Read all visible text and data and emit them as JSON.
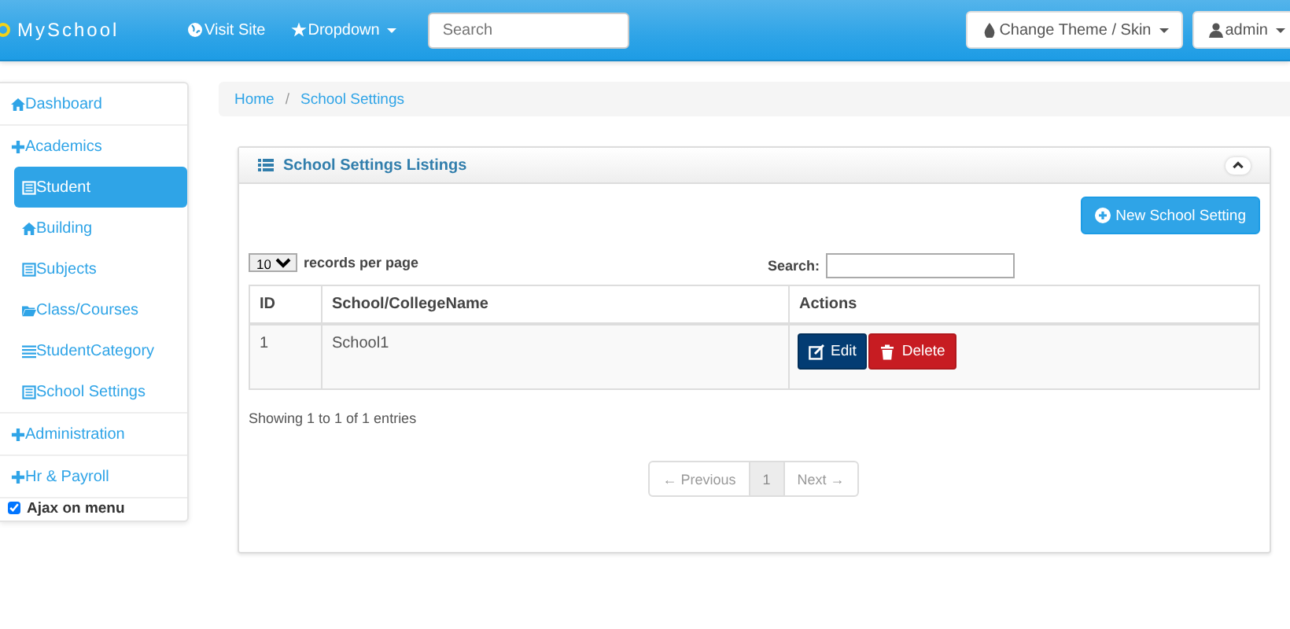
{
  "navbar": {
    "brand": "MySchool",
    "links": [
      {
        "kind": "globe",
        "label": "Visit Site",
        "caret": false
      },
      {
        "kind": "star",
        "label": "Dropdown",
        "caret": true
      }
    ],
    "search": {
      "placeholder": "Search"
    },
    "right_buttons": [
      {
        "kind": "drop",
        "label": "Change Theme / Skin"
      },
      {
        "kind": "user",
        "label": "admin"
      }
    ]
  },
  "sidebar": {
    "items": [
      {
        "kind": "home",
        "label": "Dashboard",
        "selected": false
      },
      {
        "kind": "group",
        "label": "Academics",
        "selected": false,
        "expanded": true,
        "children": [
          {
            "kind": "page",
            "label": "Student",
            "selected": true
          },
          {
            "kind": "home",
            "label": "Building",
            "selected": false
          },
          {
            "kind": "page",
            "label": "Subjects",
            "selected": false
          },
          {
            "kind": "folder",
            "label": "Class/Courses",
            "selected": false
          },
          {
            "kind": "list",
            "label": "StudentCategory",
            "selected": false
          },
          {
            "kind": "page",
            "label": "School Settings",
            "selected": false
          }
        ]
      },
      {
        "kind": "group",
        "label": "Administration",
        "selected": false
      },
      {
        "kind": "group",
        "label": "Hr & Payroll",
        "selected": false
      }
    ],
    "ajax_toggle": {
      "label": "Ajax on menu",
      "checked": true
    }
  },
  "breadcrumb": {
    "separator": "/",
    "items": [
      "Home",
      "School Settings"
    ]
  },
  "panel": {
    "title": "School Settings Listings",
    "new_button": "New School Setting",
    "page_size": "10",
    "page_size_label": "records per page",
    "search_label": "Search:",
    "table": {
      "columns": [
        "ID",
        "School/CollegeName",
        "Actions"
      ],
      "rows": [
        {
          "id": "1",
          "name": "School1",
          "actions": [
            {
              "kind": "edit",
              "label": "Edit"
            },
            {
              "kind": "delete",
              "label": "Delete"
            }
          ]
        }
      ]
    },
    "info": "Showing 1 to 1 of 1 entries",
    "pagination": [
      {
        "label": "← Previous",
        "selected": false,
        "disabled": true
      },
      {
        "label": "1",
        "selected": true,
        "disabled": false
      },
      {
        "label": "Next →",
        "selected": false,
        "disabled": true
      }
    ]
  }
}
